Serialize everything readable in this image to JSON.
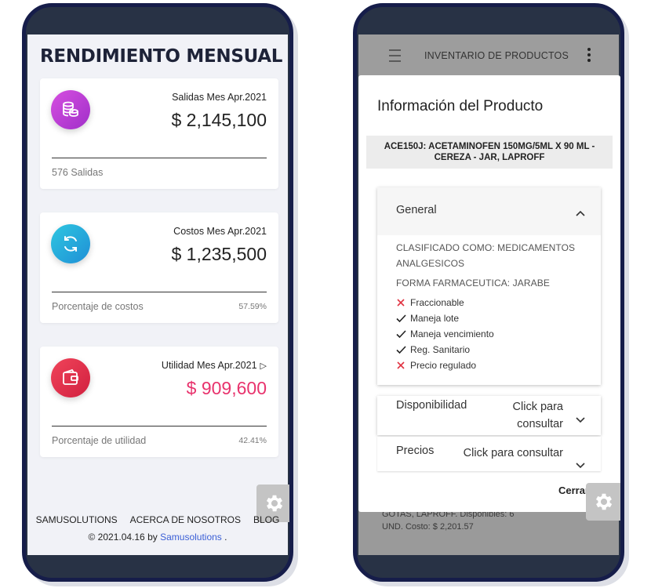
{
  "left_phone": {
    "page_title": "RENDIMIENTO MENSUAL",
    "cards": [
      {
        "label": "Salidas Mes Apr.2021",
        "amount": "$ 2,145,100",
        "footer_left": "576 Salidas",
        "footer_right": "",
        "icon": "coins-icon",
        "color": "#c03bd6"
      },
      {
        "label": "Costos Mes Apr.2021",
        "amount": "$ 1,235,500",
        "footer_left": "Porcentaje de costos",
        "footer_right": "57.59%",
        "icon": "refresh-icon",
        "color": "#22b3d6"
      },
      {
        "label": "Utilidad Mes Apr.2021",
        "amount": "$ 909,600",
        "footer_left": "Porcentaje de utilidad",
        "footer_right": "42.41%",
        "icon": "wallet-icon",
        "color": "#e8334a",
        "amount_color": "#e8336d"
      }
    ],
    "footer": {
      "links": [
        "SAMUSOLUTIONS",
        "ACERCA DE NOSOTROS",
        "BLOG"
      ],
      "copyright_prefix": "© 2021.04.16 by",
      "copyright_brand": "Samusolutions",
      "copyright_suffix": "."
    }
  },
  "right_phone": {
    "app_bar_title": "INVENTARIO DE PRODUCTOS",
    "modal": {
      "title": "Información del Producto",
      "product": "ACE150J: ACETAMINOFEN 150MG/5ML X 90 ML - CEREZA - JAR, LAPROFF",
      "general": {
        "header": "General",
        "clasificado": "CLASIFICADO COMO: MEDICAMENTOS ANALGESICOS",
        "forma": "FORMA FARMACEUTICA: JARABE",
        "flags": [
          {
            "label": "Fraccionable",
            "ok": false
          },
          {
            "label": "Maneja lote",
            "ok": true
          },
          {
            "label": "Maneja vencimiento",
            "ok": true
          },
          {
            "label": "Reg. Sanitario",
            "ok": true
          },
          {
            "label": "Precio regulado",
            "ok": false
          }
        ]
      },
      "disponibilidad": {
        "label": "Disponibilidad",
        "value": "Click para consultar"
      },
      "precios": {
        "label": "Precios",
        "value": "Click para consultar"
      },
      "close_label": "Cerrar"
    },
    "background_text": "GOTAS, LAPROFF. Disponibles: 6 UND. Costo: $ 2,201.57"
  }
}
